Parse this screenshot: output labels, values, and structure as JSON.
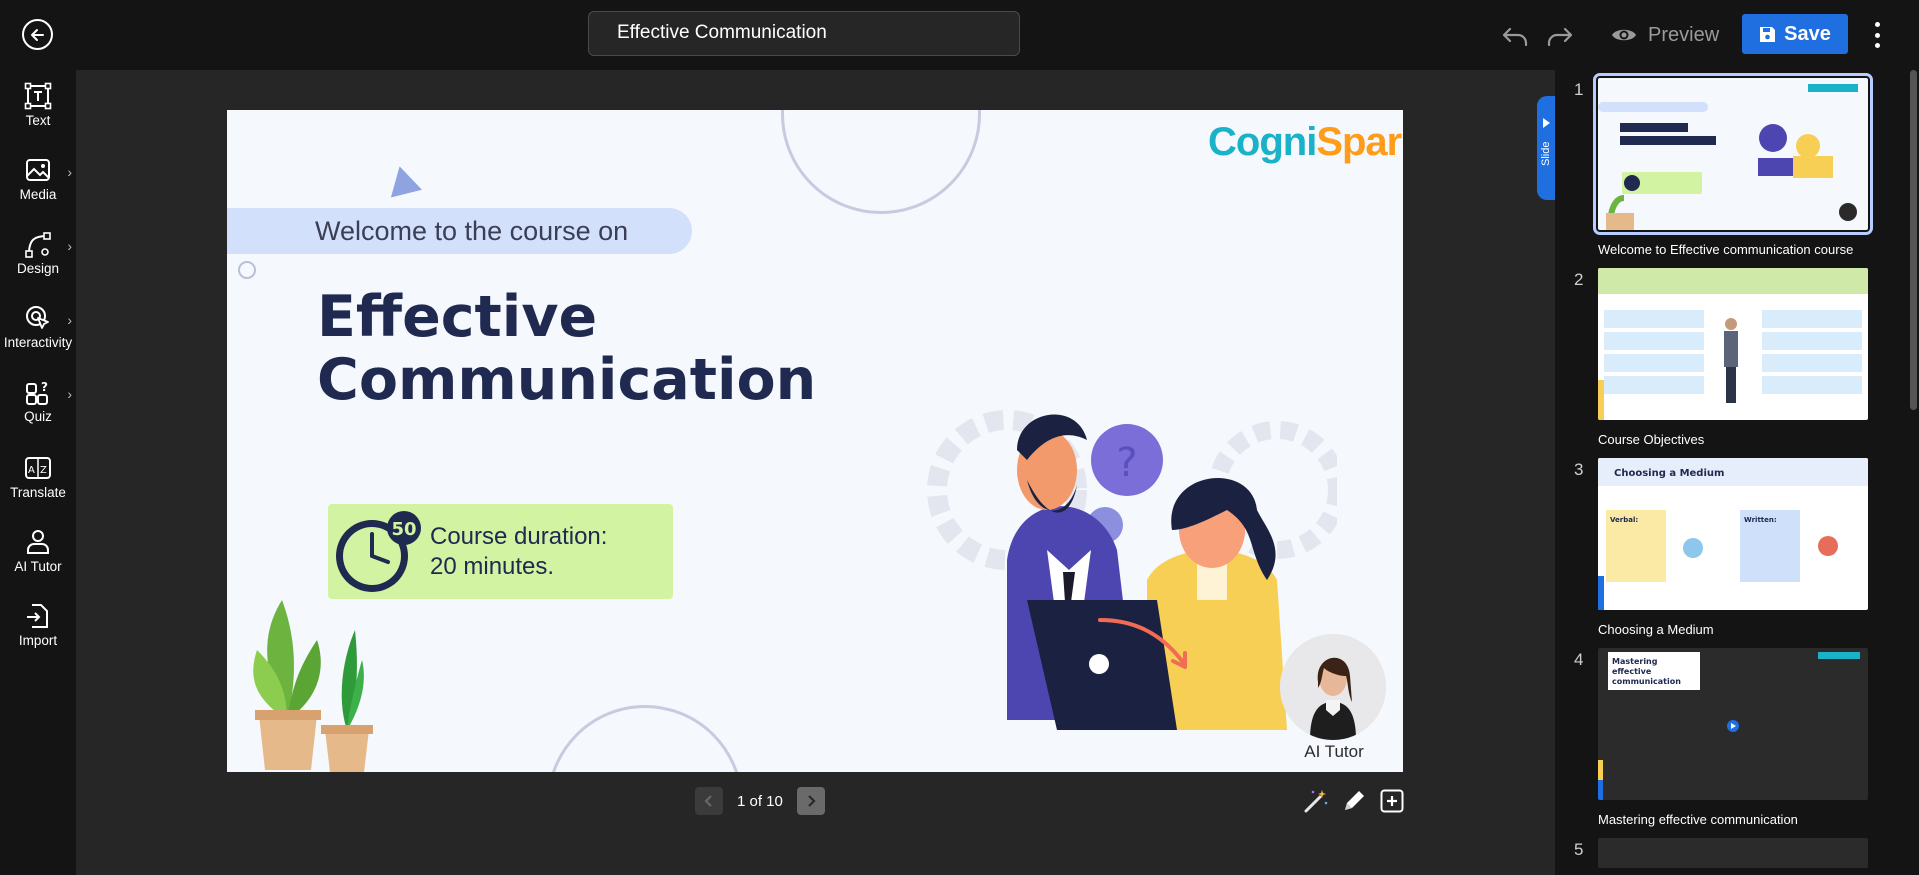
{
  "header": {
    "document_title": "Effective Communication",
    "preview_label": "Preview",
    "save_label": "Save"
  },
  "sidebar": {
    "items": [
      {
        "label": "Text",
        "icon": "text-icon"
      },
      {
        "label": "Media",
        "icon": "media-icon",
        "has_submenu": true
      },
      {
        "label": "Design",
        "icon": "design-icon",
        "has_submenu": true
      },
      {
        "label": "Interactivity",
        "icon": "interactivity-icon",
        "has_submenu": true
      },
      {
        "label": "Quiz",
        "icon": "quiz-icon",
        "has_submenu": true
      },
      {
        "label": "Translate",
        "icon": "translate-icon"
      },
      {
        "label": "AI Tutor",
        "icon": "ai-tutor-icon"
      },
      {
        "label": "Import",
        "icon": "import-icon"
      }
    ]
  },
  "canvas": {
    "welcome_text": "Welcome to the course on",
    "title_line1": "Effective",
    "title_line2": "Communication",
    "duration_text": "Course duration:\n20 minutes.",
    "clock_number": "50",
    "logo_part1": "Cogni",
    "logo_part2": "Spark",
    "tutor_label": "AI Tutor",
    "pager_text": "1 of 10"
  },
  "right_panel": {
    "tab_label": "Slide",
    "slides": [
      {
        "number": "1",
        "title": "Welcome to Effective communication course",
        "active": true
      },
      {
        "number": "2",
        "title": "Course Objectives"
      },
      {
        "number": "3",
        "title": "Choosing a Medium"
      },
      {
        "number": "4",
        "title": "Mastering effective communication"
      },
      {
        "number": "5",
        "title": ""
      }
    ],
    "thumb3_heading": "Choosing a Medium",
    "thumb3_verbal": "Verbal:",
    "thumb3_written": "Written:",
    "thumb4_heading": "Mastering effective communication"
  },
  "colors": {
    "accent": "#1f6fe0",
    "title_navy": "#20294f",
    "duration_green": "#d2f4a2",
    "welcome_pill": "#d3e0fb"
  }
}
